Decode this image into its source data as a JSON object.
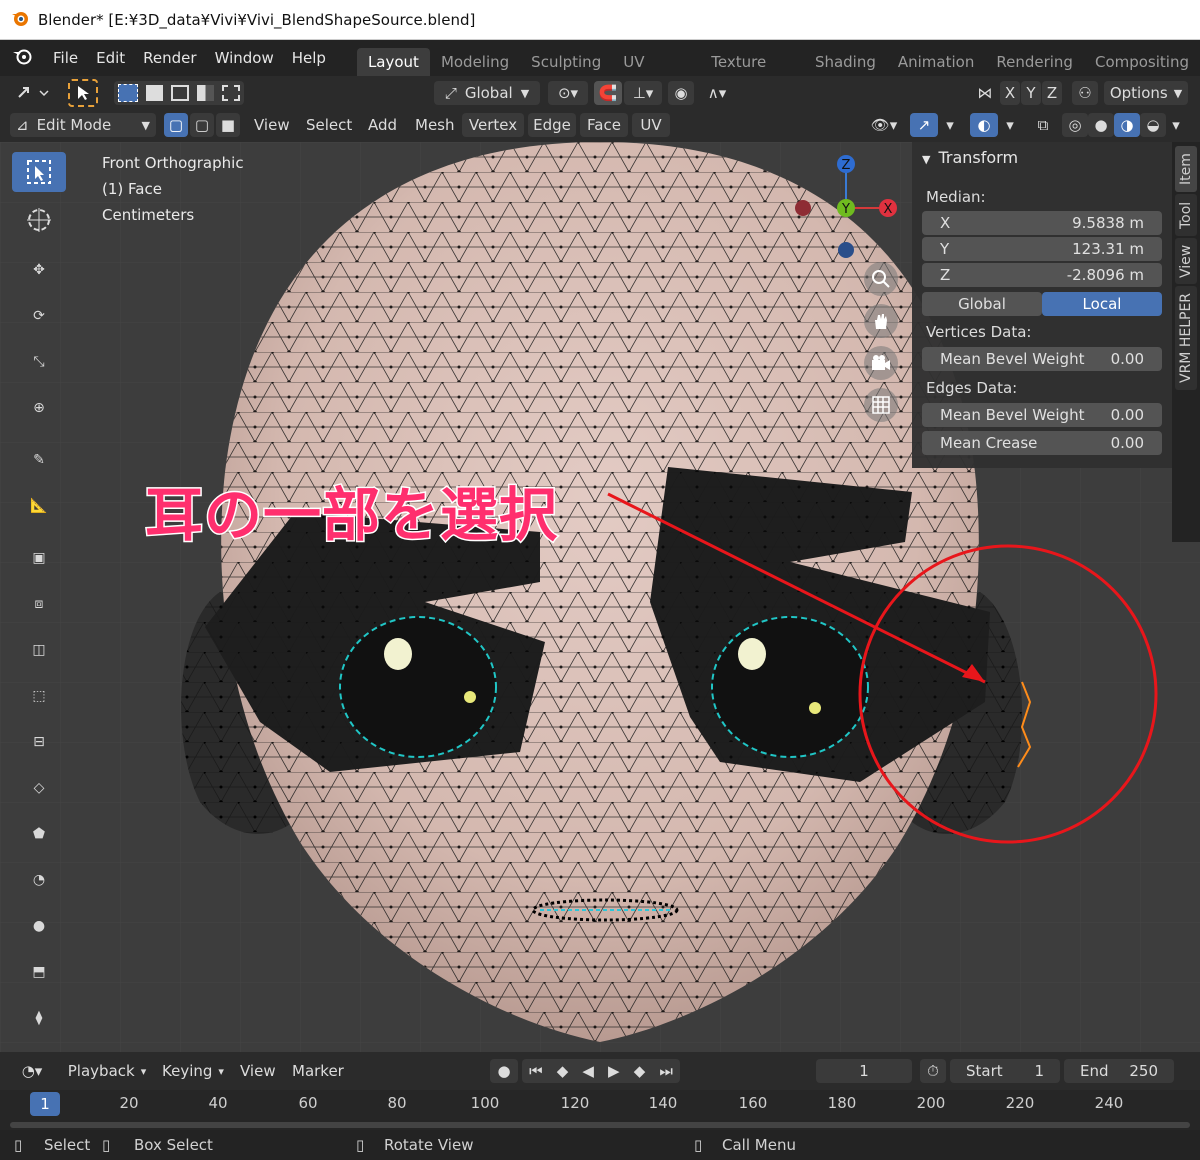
{
  "titlebar": {
    "title": "Blender* [E:¥3D_data¥Vivi¥Vivi_BlendShapeSource.blend]"
  },
  "menu": [
    "File",
    "Edit",
    "Render",
    "Window",
    "Help"
  ],
  "workspaces": [
    {
      "label": "Layout",
      "active": true
    },
    {
      "label": "Modeling"
    },
    {
      "label": "Sculpting"
    },
    {
      "label": "UV Editing"
    },
    {
      "label": "Texture Paint"
    },
    {
      "label": "Shading"
    },
    {
      "label": "Animation"
    },
    {
      "label": "Rendering"
    },
    {
      "label": "Compositing"
    }
  ],
  "tool_header": {
    "transform_orientation": "Global",
    "axes": [
      "X",
      "Y",
      "Z"
    ],
    "options": "Options"
  },
  "view_header": {
    "mode": "Edit Mode",
    "menus": [
      "View",
      "Select",
      "Add",
      "Mesh",
      "Vertex",
      "Edge",
      "Face",
      "UV"
    ]
  },
  "viewport": {
    "view_name": "Front Orthographic",
    "object_info": "(1) Face",
    "units": "Centimeters",
    "gizmo_axes": {
      "z": "Z",
      "y": "Y",
      "x": "X"
    },
    "accent_color": "#4772b3",
    "annotation": {
      "text": "耳の一部を選択",
      "color": "#ff2f6e"
    },
    "highlight_color": "#e8161b"
  },
  "n_panel": {
    "title": "Transform",
    "median_label": "Median:",
    "x": {
      "label": "X",
      "value": "9.5838 m"
    },
    "y": {
      "label": "Y",
      "value": "123.31 m"
    },
    "z": {
      "label": "Z",
      "value": "-2.8096 m"
    },
    "space_global": "Global",
    "space_local": "Local",
    "vertices_label": "Vertices Data:",
    "vertex_bevel": {
      "label": "Mean Bevel Weight",
      "value": "0.00"
    },
    "edges_label": "Edges Data:",
    "edge_bevel": {
      "label": "Mean Bevel Weight",
      "value": "0.00"
    },
    "edge_crease": {
      "label": "Mean Crease",
      "value": "0.00"
    },
    "tabs": [
      "Item",
      "Tool",
      "View",
      "VRM HELPER"
    ]
  },
  "timeline": {
    "menus": [
      "Playback",
      "Keying",
      "View",
      "Marker"
    ],
    "current_frame": "1",
    "start_label": "Start",
    "start_value": "1",
    "end_label": "End",
    "end_value": "250",
    "ruler_current": "1",
    "ruler_ticks": [
      "20",
      "40",
      "60",
      "80",
      "100",
      "120",
      "140",
      "160",
      "180",
      "200",
      "220",
      "240"
    ]
  },
  "status": {
    "select": "Select",
    "box_select": "Box Select",
    "rotate_view": "Rotate View",
    "call_menu": "Call Menu"
  }
}
